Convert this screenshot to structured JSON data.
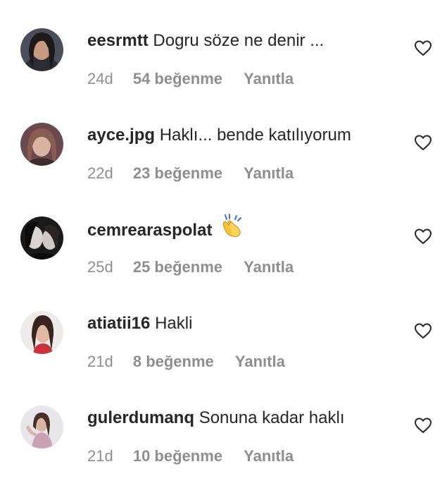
{
  "comments": [
    {
      "username": "eesrmtt",
      "text": "Dogru söze ne denir ...",
      "time": "24d",
      "likes": "54 beğenme",
      "reply": "Yanıtla",
      "avatar_icon": "profile-photo"
    },
    {
      "username": "ayce.jpg",
      "text": "Haklı... bende katılıyorum",
      "time": "22d",
      "likes": "23 beğenme",
      "reply": "Yanıtla",
      "avatar_icon": "profile-photo"
    },
    {
      "username": "cemrearaspolat",
      "text": "",
      "emoji": "clapping-hands-emoji",
      "time": "25d",
      "likes": "25 beğenme",
      "reply": "Yanıtla",
      "avatar_icon": "profile-photo"
    },
    {
      "username": "atiatii16",
      "text": "Hakli",
      "time": "21d",
      "likes": "8 beğenme",
      "reply": "Yanıtla",
      "avatar_icon": "profile-photo"
    },
    {
      "username": "gulerdumanq",
      "text": "Sonuna kadar haklı",
      "time": "21d",
      "likes": "10 beğenme",
      "reply": "Yanıtla",
      "avatar_icon": "profile-photo"
    }
  ],
  "colors": {
    "text_primary": "#262626",
    "text_secondary": "#8e8e8e",
    "background": "#ffffff"
  },
  "icons": {
    "like": "heart-outline-icon"
  }
}
